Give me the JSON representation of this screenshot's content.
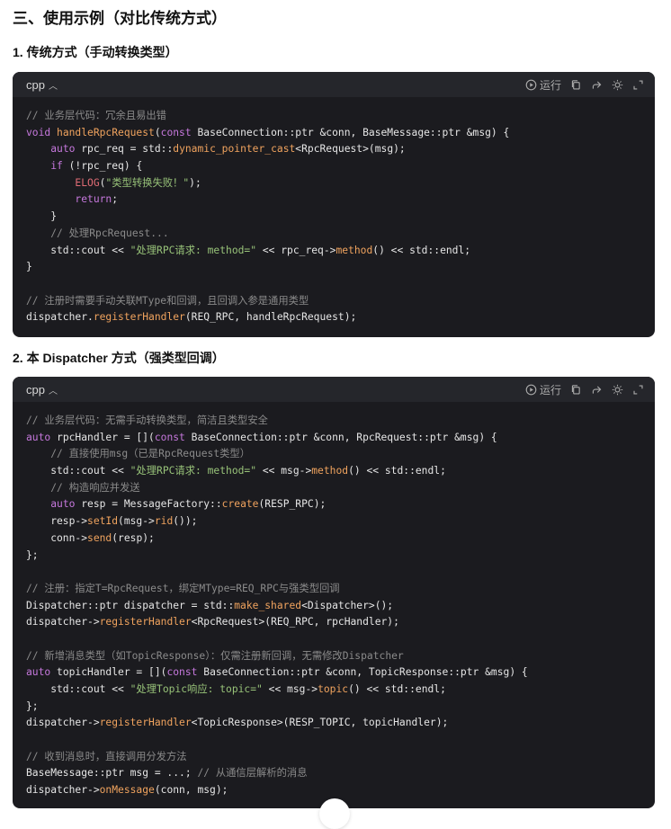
{
  "heading": "三、使用示例（对比传统方式）",
  "sections": [
    {
      "title": "1. 传统方式（手动转换类型）",
      "lang": "cpp",
      "run_label": "运行",
      "lines": [
        [
          {
            "t": "// 业务层代码：冗余且易出错",
            "c": "cm"
          }
        ],
        [
          {
            "t": "void ",
            "c": "kw"
          },
          {
            "t": "handleRpcRequest",
            "c": "fn"
          },
          {
            "t": "("
          },
          {
            "t": "const ",
            "c": "kw"
          },
          {
            "t": "BaseConnection::ptr &conn, BaseMessage::ptr &msg) {"
          }
        ],
        [
          {
            "t": "    "
          },
          {
            "t": "auto ",
            "c": "kw"
          },
          {
            "t": "rpc_req = std::"
          },
          {
            "t": "dynamic_pointer_cast",
            "c": "fn"
          },
          {
            "t": "<RpcRequest>(msg);"
          }
        ],
        [
          {
            "t": "    "
          },
          {
            "t": "if ",
            "c": "kw"
          },
          {
            "t": "(!rpc_req) {"
          }
        ],
        [
          {
            "t": "        "
          },
          {
            "t": "ELOG",
            "c": "mc"
          },
          {
            "t": "("
          },
          {
            "t": "\"类型转换失败！\"",
            "c": "st"
          },
          {
            "t": ");"
          }
        ],
        [
          {
            "t": "        "
          },
          {
            "t": "return",
            "c": "kw"
          },
          {
            "t": ";"
          }
        ],
        [
          {
            "t": "    }"
          }
        ],
        [
          {
            "t": "    "
          },
          {
            "t": "// 处理RpcRequest...",
            "c": "cm"
          }
        ],
        [
          {
            "t": "    std::cout << "
          },
          {
            "t": "\"处理RPC请求: method=\"",
            "c": "st"
          },
          {
            "t": " << rpc_req->"
          },
          {
            "t": "method",
            "c": "fn"
          },
          {
            "t": "() << std::endl;"
          }
        ],
        [
          {
            "t": "}"
          }
        ],
        [
          {
            "t": ""
          }
        ],
        [
          {
            "t": "// 注册时需要手动关联MType和回调，且回调入参是通用类型",
            "c": "cm"
          }
        ],
        [
          {
            "t": "dispatcher."
          },
          {
            "t": "registerHandler",
            "c": "fn"
          },
          {
            "t": "(REQ_RPC, handleRpcRequest);"
          }
        ]
      ]
    },
    {
      "title": "2. 本 Dispatcher 方式（强类型回调）",
      "lang": "cpp",
      "run_label": "运行",
      "lines": [
        [
          {
            "t": "// 业务层代码：无需手动转换类型，简洁且类型安全",
            "c": "cm"
          }
        ],
        [
          {
            "t": "auto ",
            "c": "kw"
          },
          {
            "t": "rpcHandler = []("
          },
          {
            "t": "const ",
            "c": "kw"
          },
          {
            "t": "BaseConnection::ptr &conn, RpcRequest::ptr &msg) {"
          }
        ],
        [
          {
            "t": "    "
          },
          {
            "t": "// 直接使用msg（已是RpcRequest类型）",
            "c": "cm"
          }
        ],
        [
          {
            "t": "    std::cout << "
          },
          {
            "t": "\"处理RPC请求: method=\"",
            "c": "st"
          },
          {
            "t": " << msg->"
          },
          {
            "t": "method",
            "c": "fn"
          },
          {
            "t": "() << std::endl;"
          }
        ],
        [
          {
            "t": "    "
          },
          {
            "t": "// 构造响应并发送",
            "c": "cm"
          }
        ],
        [
          {
            "t": "    "
          },
          {
            "t": "auto ",
            "c": "kw"
          },
          {
            "t": "resp = MessageFactory::"
          },
          {
            "t": "create",
            "c": "fn"
          },
          {
            "t": "(RESP_RPC);"
          }
        ],
        [
          {
            "t": "    resp->"
          },
          {
            "t": "setId",
            "c": "fn"
          },
          {
            "t": "(msg->"
          },
          {
            "t": "rid",
            "c": "fn"
          },
          {
            "t": "());"
          }
        ],
        [
          {
            "t": "    conn->"
          },
          {
            "t": "send",
            "c": "fn"
          },
          {
            "t": "(resp);"
          }
        ],
        [
          {
            "t": "};"
          }
        ],
        [
          {
            "t": ""
          }
        ],
        [
          {
            "t": "// 注册：指定T=RpcRequest，绑定MType=REQ_RPC与强类型回调",
            "c": "cm"
          }
        ],
        [
          {
            "t": "Dispatcher::ptr dispatcher = std::"
          },
          {
            "t": "make_shared",
            "c": "fn"
          },
          {
            "t": "<Dispatcher>();"
          }
        ],
        [
          {
            "t": "dispatcher->"
          },
          {
            "t": "registerHandler",
            "c": "fn"
          },
          {
            "t": "<RpcRequest>(REQ_RPC, rpcHandler);"
          }
        ],
        [
          {
            "t": ""
          }
        ],
        [
          {
            "t": "// 新增消息类型（如TopicResponse）：仅需注册新回调，无需修改Dispatcher",
            "c": "cm"
          }
        ],
        [
          {
            "t": "auto ",
            "c": "kw"
          },
          {
            "t": "topicHandler = []("
          },
          {
            "t": "const ",
            "c": "kw"
          },
          {
            "t": "BaseConnection::ptr &conn, TopicResponse::ptr &msg) {"
          }
        ],
        [
          {
            "t": "    std::cout << "
          },
          {
            "t": "\"处理Topic响应: topic=\"",
            "c": "st"
          },
          {
            "t": " << msg->"
          },
          {
            "t": "topic",
            "c": "fn"
          },
          {
            "t": "() << std::endl;"
          }
        ],
        [
          {
            "t": "};"
          }
        ],
        [
          {
            "t": "dispatcher->"
          },
          {
            "t": "registerHandler",
            "c": "fn"
          },
          {
            "t": "<TopicResponse>(RESP_TOPIC, topicHandler);"
          }
        ],
        [
          {
            "t": ""
          }
        ],
        [
          {
            "t": "// 收到消息时，直接调用分发方法",
            "c": "cm"
          }
        ],
        [
          {
            "t": "BaseMessage::ptr msg = ...; "
          },
          {
            "t": "// 从通信层解析的消息",
            "c": "cm"
          }
        ],
        [
          {
            "t": "dispatcher->"
          },
          {
            "t": "onMessage",
            "c": "fn"
          },
          {
            "t": "(conn, msg);"
          }
        ]
      ]
    }
  ]
}
